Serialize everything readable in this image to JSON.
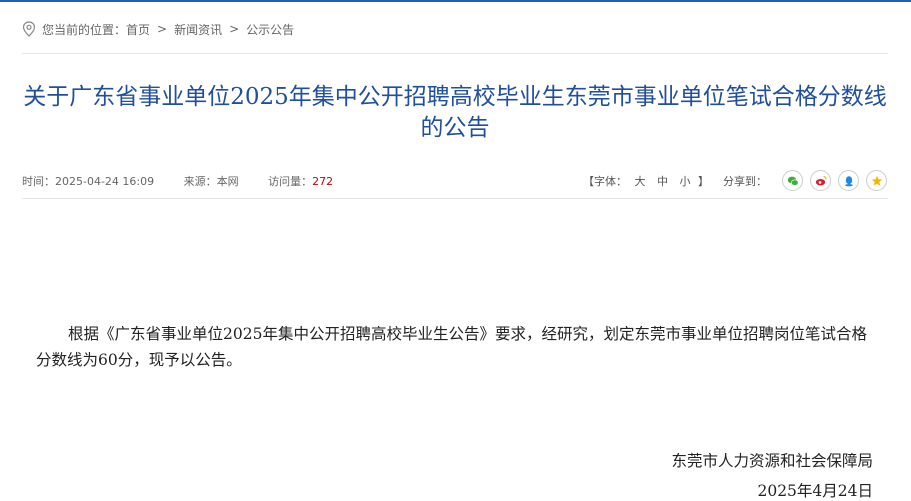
{
  "breadcrumb": {
    "label": "您当前的位置：",
    "items": [
      "首页",
      "新闻资讯",
      "公示公告"
    ],
    "separator": ">"
  },
  "article": {
    "title_line1": "关于广东省事业单位2025年集中公开招聘高校毕业生东莞市事业单位笔试合格分数线",
    "title_line2": "的公告",
    "time": "时间：2025-04-24 16:09",
    "source": "来源：本网",
    "views_label": "访问量：",
    "views_value": "272",
    "body": "根据《广东省事业单位2025年集中公开招聘高校毕业生公告》要求，经研究，划定东莞市事业单位招聘岗位笔试合格分数线为60分，现予以公告。",
    "signature": "东莞市人力资源和社会保障局",
    "date": "2025年4月24日"
  },
  "toolbar": {
    "font_open": "【字体：",
    "font_large": "大",
    "font_medium": "中",
    "font_small": "小",
    "font_close": "】",
    "share_label": "分享到："
  },
  "share_icons": [
    "wechat-icon",
    "weibo-icon",
    "qq-icon",
    "qzone-icon"
  ],
  "colors": {
    "title": "#1f4f9e",
    "accent": "#1f5fb5",
    "views": "#cc0000",
    "wechat": "#3cb034",
    "weibo": "#e6162d",
    "qq": "#1e88e5",
    "qzone": "#f5b400"
  }
}
